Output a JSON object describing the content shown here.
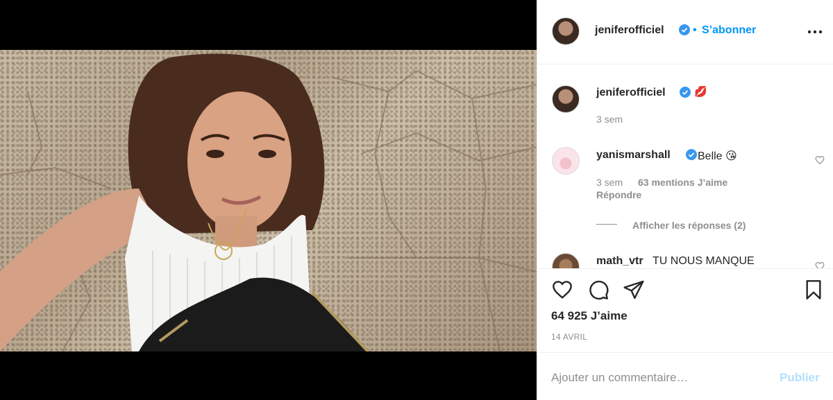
{
  "header": {
    "username": "jeniferofficiel",
    "separator": "•",
    "follow_label": "S’abonner",
    "more_icon": "more-dots-icon"
  },
  "caption": {
    "username": "jeniferofficiel",
    "emoji": "💋",
    "time": "3 sem"
  },
  "comments": [
    {
      "username": "yanismarshall",
      "text": "Belle 😘",
      "time": "3 sem",
      "likes": "63 mentions J’aime",
      "reply_label": "Répondre",
      "view_replies_label": "Afficher les réponses (2)"
    },
    {
      "username": "math_vtr",
      "text": "TU NOUS MANQUE"
    }
  ],
  "actions": {
    "likes_count": "64 925 J’aime",
    "date": "14 AVRIL"
  },
  "add_comment": {
    "placeholder": "Ajouter un commentaire…",
    "publish_label": "Publier"
  },
  "colors": {
    "accent": "#0095f6",
    "accent_disabled": "#b2dffc",
    "verified": "#3897f0",
    "muted": "#8e8e8e"
  }
}
